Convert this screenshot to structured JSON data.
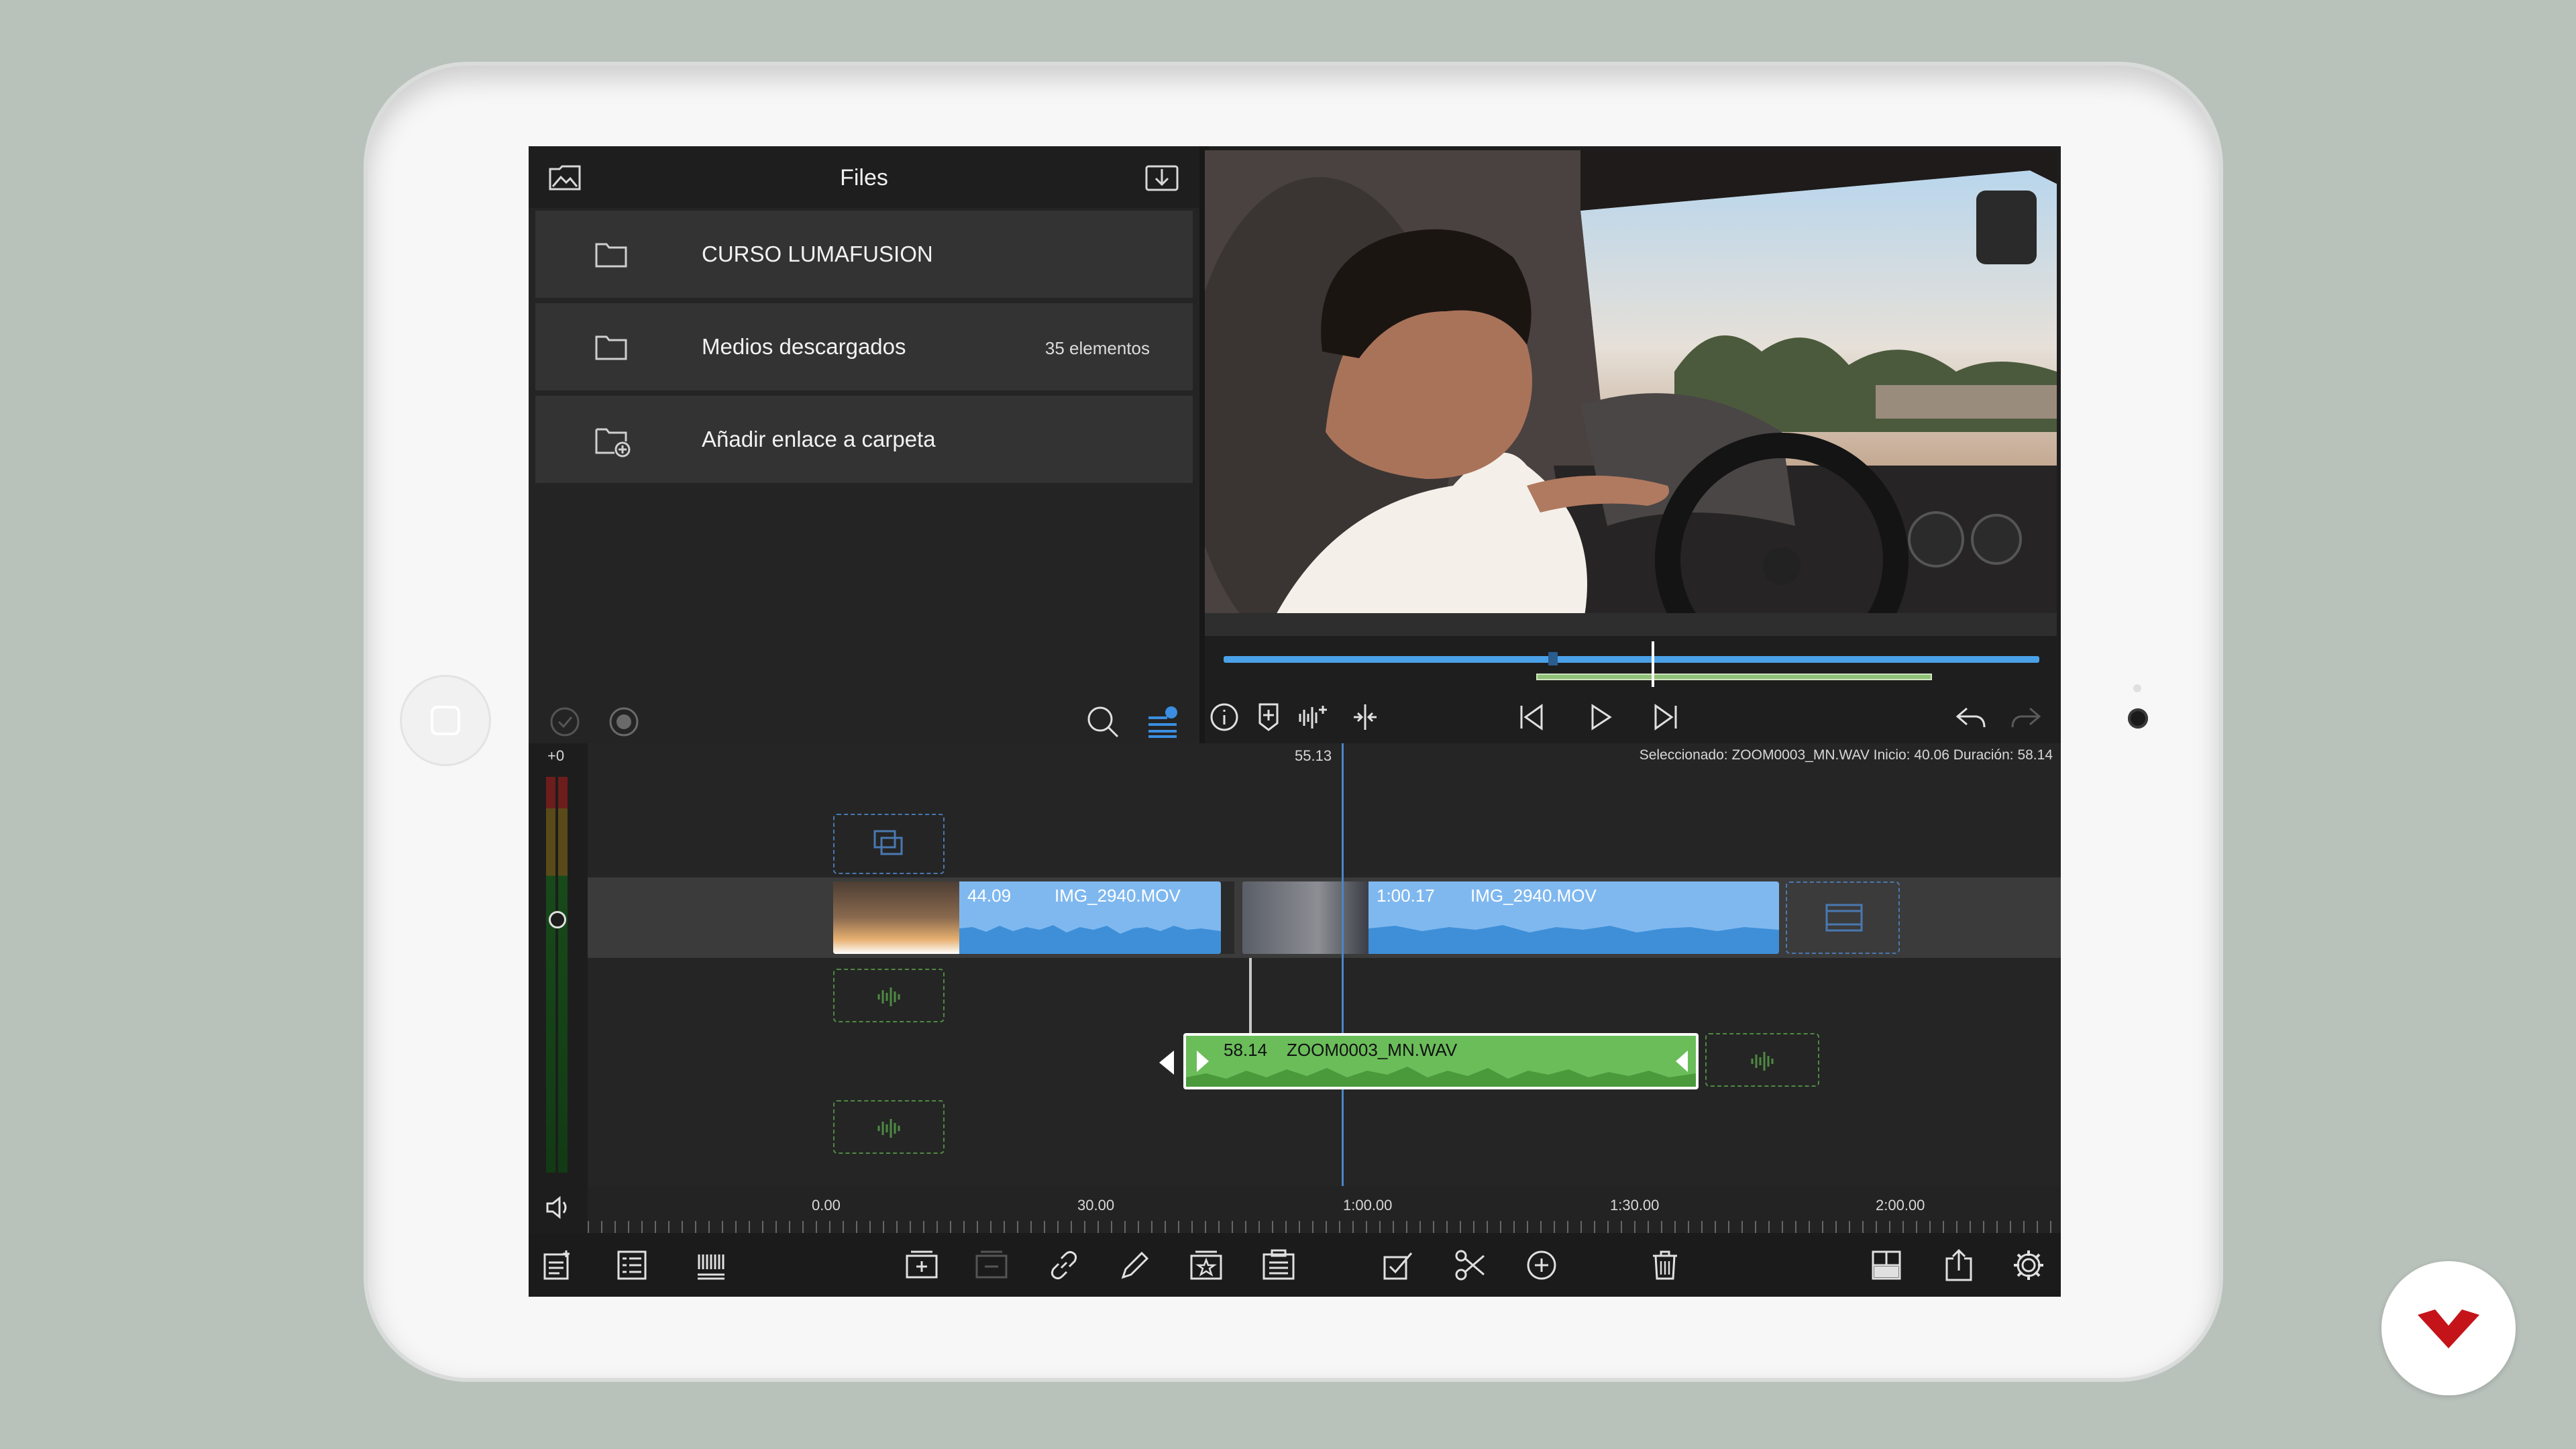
{
  "files": {
    "title": "Files",
    "items": [
      {
        "label": "CURSO LUMAFUSION",
        "count": ""
      },
      {
        "label": "Medios descargados",
        "count": "35 elementos"
      },
      {
        "label": "Añadir enlace a carpeta",
        "count": ""
      }
    ]
  },
  "timeline": {
    "level_label": "+0",
    "playhead_time": "55.13",
    "selection_info": "Seleccionado: ZOOM0003_MN.WAV Inicio: 40.06 Duración: 58.14",
    "clips": [
      {
        "duration": "44.09",
        "name": "IMG_2940.MOV"
      },
      {
        "duration": "1:00.17",
        "name": "IMG_2940.MOV"
      },
      {
        "duration": "58.14",
        "name": "ZOOM0003_MN.WAV"
      }
    ],
    "ruler_ticks": [
      "0.00",
      "30.00",
      "1:00.00",
      "1:30.00",
      "2:00.00"
    ]
  },
  "icons": {
    "files_header": [
      "photo-library-icon",
      "import-icon"
    ],
    "files_rows": [
      "folder-icon",
      "folder-icon",
      "add-folder-link-icon"
    ],
    "viewer_controls": [
      "info-icon",
      "add-marker-icon",
      "audio-add-icon",
      "split-view-icon",
      "skip-back-icon",
      "play-icon",
      "skip-forward-icon",
      "undo-icon",
      "redo-icon"
    ],
    "toolbar": [
      "add-track-icon",
      "list-view-icon",
      "grid-view-icon",
      "insert-clip-icon",
      "overwrite-clip-icon",
      "link-icon",
      "edit-icon",
      "favorite-icon",
      "titles-icon",
      "select-icon",
      "cut-icon",
      "add-icon",
      "delete-icon",
      "layout-icon",
      "share-icon",
      "settings-icon"
    ]
  },
  "colors": {
    "video_clip": "#7fb8ef",
    "audio_clip": "#6bbd5a",
    "playhead": "#4a86c8",
    "scrub_bar": "#4aa1e8"
  }
}
